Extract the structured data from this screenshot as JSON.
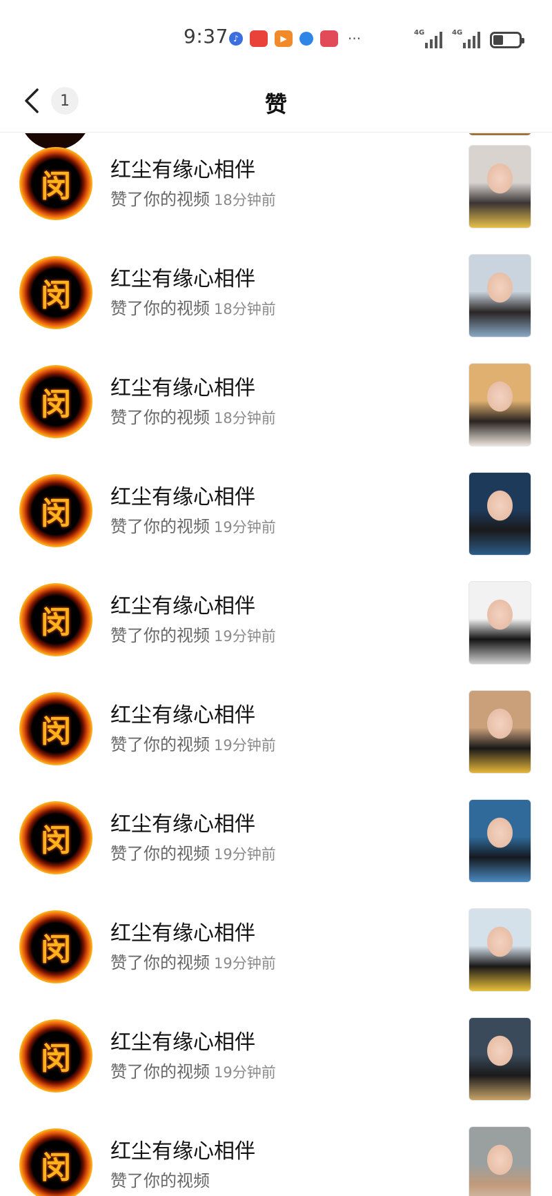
{
  "status_bar": {
    "time": "9:37",
    "dots": "···",
    "network_1": "4G",
    "network_2": "4G",
    "apps": [
      {
        "icon": "music-app-icon",
        "color": "#3b6fe0"
      },
      {
        "icon": "huawei-store-icon",
        "color": "#e8423a"
      },
      {
        "icon": "video-app-icon",
        "color": "#f08a2a"
      },
      {
        "icon": "browser-app-icon",
        "color": "#2f86e6"
      },
      {
        "icon": "reader-app-icon",
        "color": "#e24a5a"
      }
    ]
  },
  "nav": {
    "back_icon": "chevron-left-icon",
    "badge": "1",
    "title": "赞"
  },
  "items": [
    {
      "name": "红尘有缘心相伴",
      "action": "赞了你的视频",
      "time": "18分钟前",
      "thumb_colors": [
        "#d8d3cf",
        "#3a3434",
        "#e6c04a"
      ]
    },
    {
      "name": "红尘有缘心相伴",
      "action": "赞了你的视频",
      "time": "18分钟前",
      "thumb_colors": [
        "#c9d4de",
        "#2a2626",
        "#8aa8c4"
      ]
    },
    {
      "name": "红尘有缘心相伴",
      "action": "赞了你的视频",
      "time": "18分钟前",
      "thumb_colors": [
        "#e0b070",
        "#2a2420",
        "#eae4dc"
      ]
    },
    {
      "name": "红尘有缘心相伴",
      "action": "赞了你的视频",
      "time": "19分钟前",
      "thumb_colors": [
        "#1e3a5a",
        "#1a1a1a",
        "#2c5c88"
      ]
    },
    {
      "name": "红尘有缘心相伴",
      "action": "赞了你的视频",
      "time": "19分钟前",
      "thumb_colors": [
        "#f2f2f2",
        "#141414",
        "#cfcfcf"
      ]
    },
    {
      "name": "红尘有缘心相伴",
      "action": "赞了你的视频",
      "time": "19分钟前",
      "thumb_colors": [
        "#c9a07a",
        "#181818",
        "#e6b63a"
      ]
    },
    {
      "name": "红尘有缘心相伴",
      "action": "赞了你的视频",
      "time": "19分钟前",
      "thumb_colors": [
        "#2f6a9a",
        "#151a20",
        "#4a8ac0"
      ]
    },
    {
      "name": "红尘有缘心相伴",
      "action": "赞了你的视频",
      "time": "19分钟前",
      "thumb_colors": [
        "#d4e0ea",
        "#1a1818",
        "#e8c03a"
      ]
    },
    {
      "name": "红尘有缘心相伴",
      "action": "赞了你的视频",
      "time": "19分钟前",
      "thumb_colors": [
        "#3a4a5a",
        "#1a1a1a",
        "#c8a46a"
      ]
    },
    {
      "name": "红尘有缘心相伴",
      "action": "赞了你的视频",
      "time": "",
      "thumb_colors": [
        "#9aa0a0",
        "#c09a7a",
        "#dcd0c0"
      ]
    }
  ]
}
